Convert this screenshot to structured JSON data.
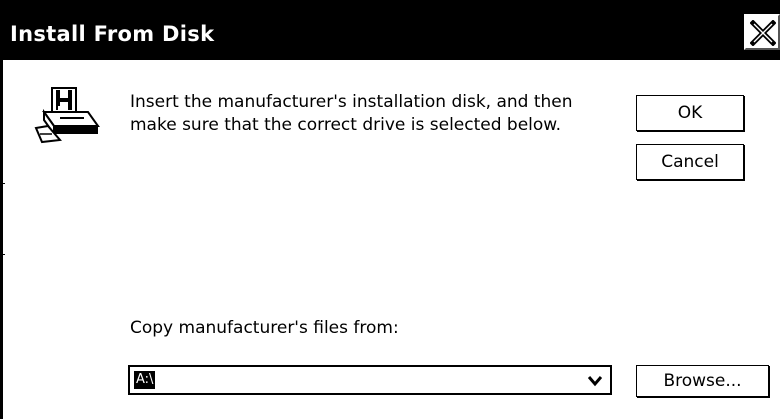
{
  "window": {
    "title": "Install From Disk"
  },
  "message": {
    "line1": "Insert the manufacturer's installation disk, and then",
    "line2": "make sure that the correct drive is selected below."
  },
  "buttons": {
    "ok": "OK",
    "cancel": "Cancel",
    "browse": "Browse..."
  },
  "copy_from": {
    "label": "Copy manufacturer's files from:",
    "value": "A:\\"
  },
  "icons": {
    "close": "close-icon",
    "disk": "install-disk-icon",
    "dropdown": "chevron-down-icon"
  },
  "colors": {
    "titlebar": "#000000",
    "background": "#ffffff",
    "text": "#000000"
  }
}
